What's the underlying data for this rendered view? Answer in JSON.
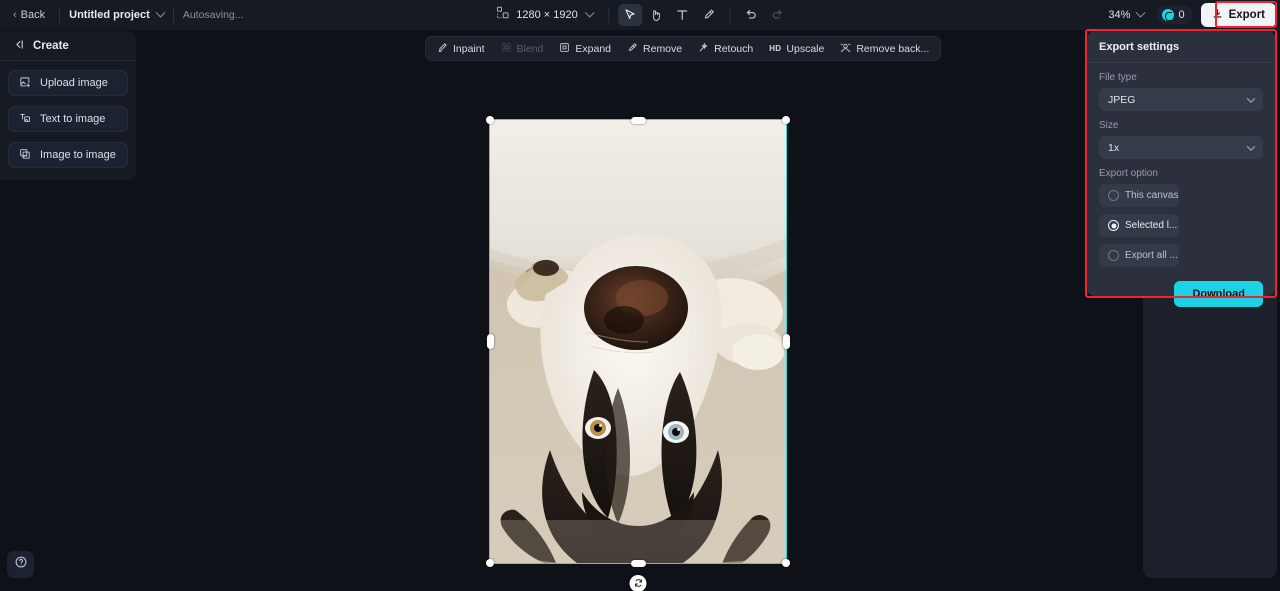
{
  "topbar": {
    "back_label": "Back",
    "project_name": "Untitled project",
    "autosave_status": "Autosaving...",
    "canvas_dimensions": "1280 × 1920",
    "zoom_level": "34%",
    "credits_count": "0",
    "export_label": "Export",
    "tools": [
      {
        "name": "select-tool",
        "active": true
      },
      {
        "name": "hand-tool",
        "active": false
      },
      {
        "name": "text-tool",
        "active": false
      },
      {
        "name": "brush-tool",
        "active": false
      }
    ],
    "undo_label": "Undo",
    "redo_label": "Redo"
  },
  "sidebar": {
    "header": "Create",
    "items": [
      {
        "label": "Upload image",
        "icon": "upload-image-icon"
      },
      {
        "label": "Text to image",
        "icon": "text-to-image-icon"
      },
      {
        "label": "Image to image",
        "icon": "image-to-image-icon"
      }
    ],
    "help_label": "Help"
  },
  "edit_toolbar": {
    "items": [
      {
        "label": "Inpaint",
        "disabled": false
      },
      {
        "label": "Blend",
        "disabled": true
      },
      {
        "label": "Expand",
        "disabled": false
      },
      {
        "label": "Remove",
        "disabled": false
      },
      {
        "label": "Retouch",
        "disabled": false
      },
      {
        "label": "Upscale",
        "disabled": false,
        "badge": "HD"
      },
      {
        "label": "Remove back...",
        "disabled": false
      }
    ]
  },
  "canvas": {
    "image_description": "Upside-down husky dog lying on back under a shelf",
    "selection_color": "#2ed9d9"
  },
  "export_panel": {
    "title": "Export settings",
    "file_type_label": "File type",
    "file_type_value": "JPEG",
    "size_label": "Size",
    "size_value": "1x",
    "export_option_label": "Export option",
    "options": [
      {
        "label": "This canvas",
        "selected": false
      },
      {
        "label": "Selected l...",
        "selected": true
      },
      {
        "label": "Export all ...",
        "selected": false
      }
    ],
    "download_label": "Download",
    "accent_color": "#1ed2e6",
    "highlight_color": "#f4212e"
  }
}
